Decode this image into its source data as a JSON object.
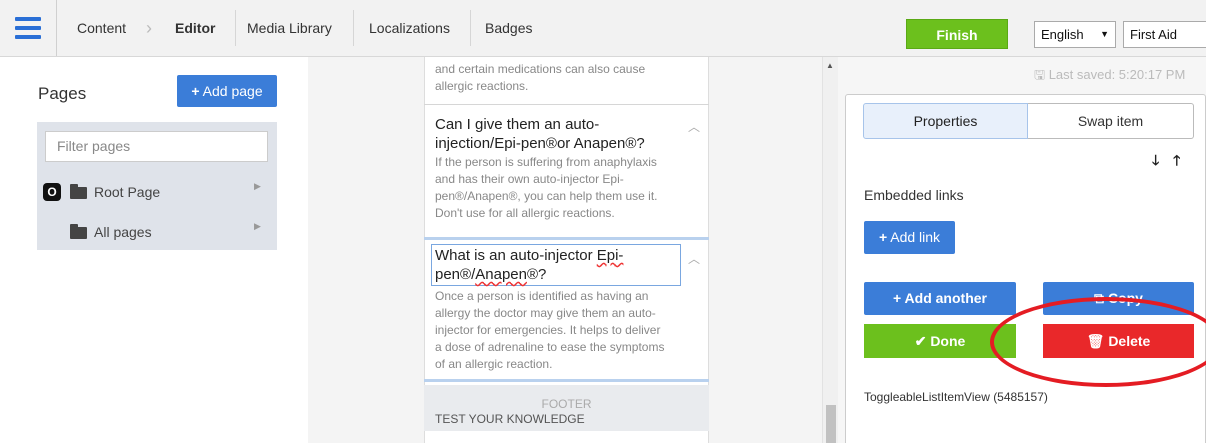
{
  "topbar": {
    "nav": [
      "Content",
      "Editor",
      "Media Library",
      "Localizations",
      "Badges"
    ],
    "finish_label": "Finish",
    "language": "English",
    "category": "First Aid"
  },
  "sidebar": {
    "title": "Pages",
    "add_page_label": "Add page",
    "filter_placeholder": "Filter pages",
    "tree": [
      {
        "badge": "O",
        "label": "Root Page"
      },
      {
        "label": "All pages"
      }
    ]
  },
  "content": {
    "prev_item_tail": [
      "and certain medications can also cause",
      "allergic reactions."
    ],
    "items": [
      {
        "title": [
          "Can I give them an auto-",
          "injection/Epi-pen®or Anapen®?"
        ],
        "body": [
          "If the person is suffering from anaphylaxis",
          "and has their own auto-injector Epi-",
          "pen®/Anapen®, you can help them use it.",
          "Don't use for all allergic reactions."
        ]
      },
      {
        "title": [
          "What is an auto-injector ",
          "Epi-",
          "pen®/",
          "Anapen",
          "®?"
        ],
        "body": [
          "Once a person is identified as having an",
          "allergy the doctor may give them an auto-",
          "injector for emergencies. It helps to deliver",
          "a dose of adrenaline to ease the symptoms",
          "of an allergic reaction."
        ]
      }
    ],
    "footer_label": "FOOTER",
    "footer_text": "TEST YOUR KNOWLEDGE"
  },
  "panel": {
    "last_saved": "Last saved: 5:20:17 PM",
    "tabs": [
      "Properties",
      "Swap item"
    ],
    "embedded_links_title": "Embedded links",
    "add_link_label": "Add link",
    "add_another_label": "Add another",
    "copy_label": "Copy",
    "done_label": "Done",
    "delete_label": "Delete",
    "view_name": "ToggleableListItemView (5485157)"
  },
  "colors": {
    "accent_blue": "#3b7dd8",
    "finish_green": "#6cc01d",
    "delete_red": "#e9282a",
    "annotation_red": "#e41c23"
  }
}
